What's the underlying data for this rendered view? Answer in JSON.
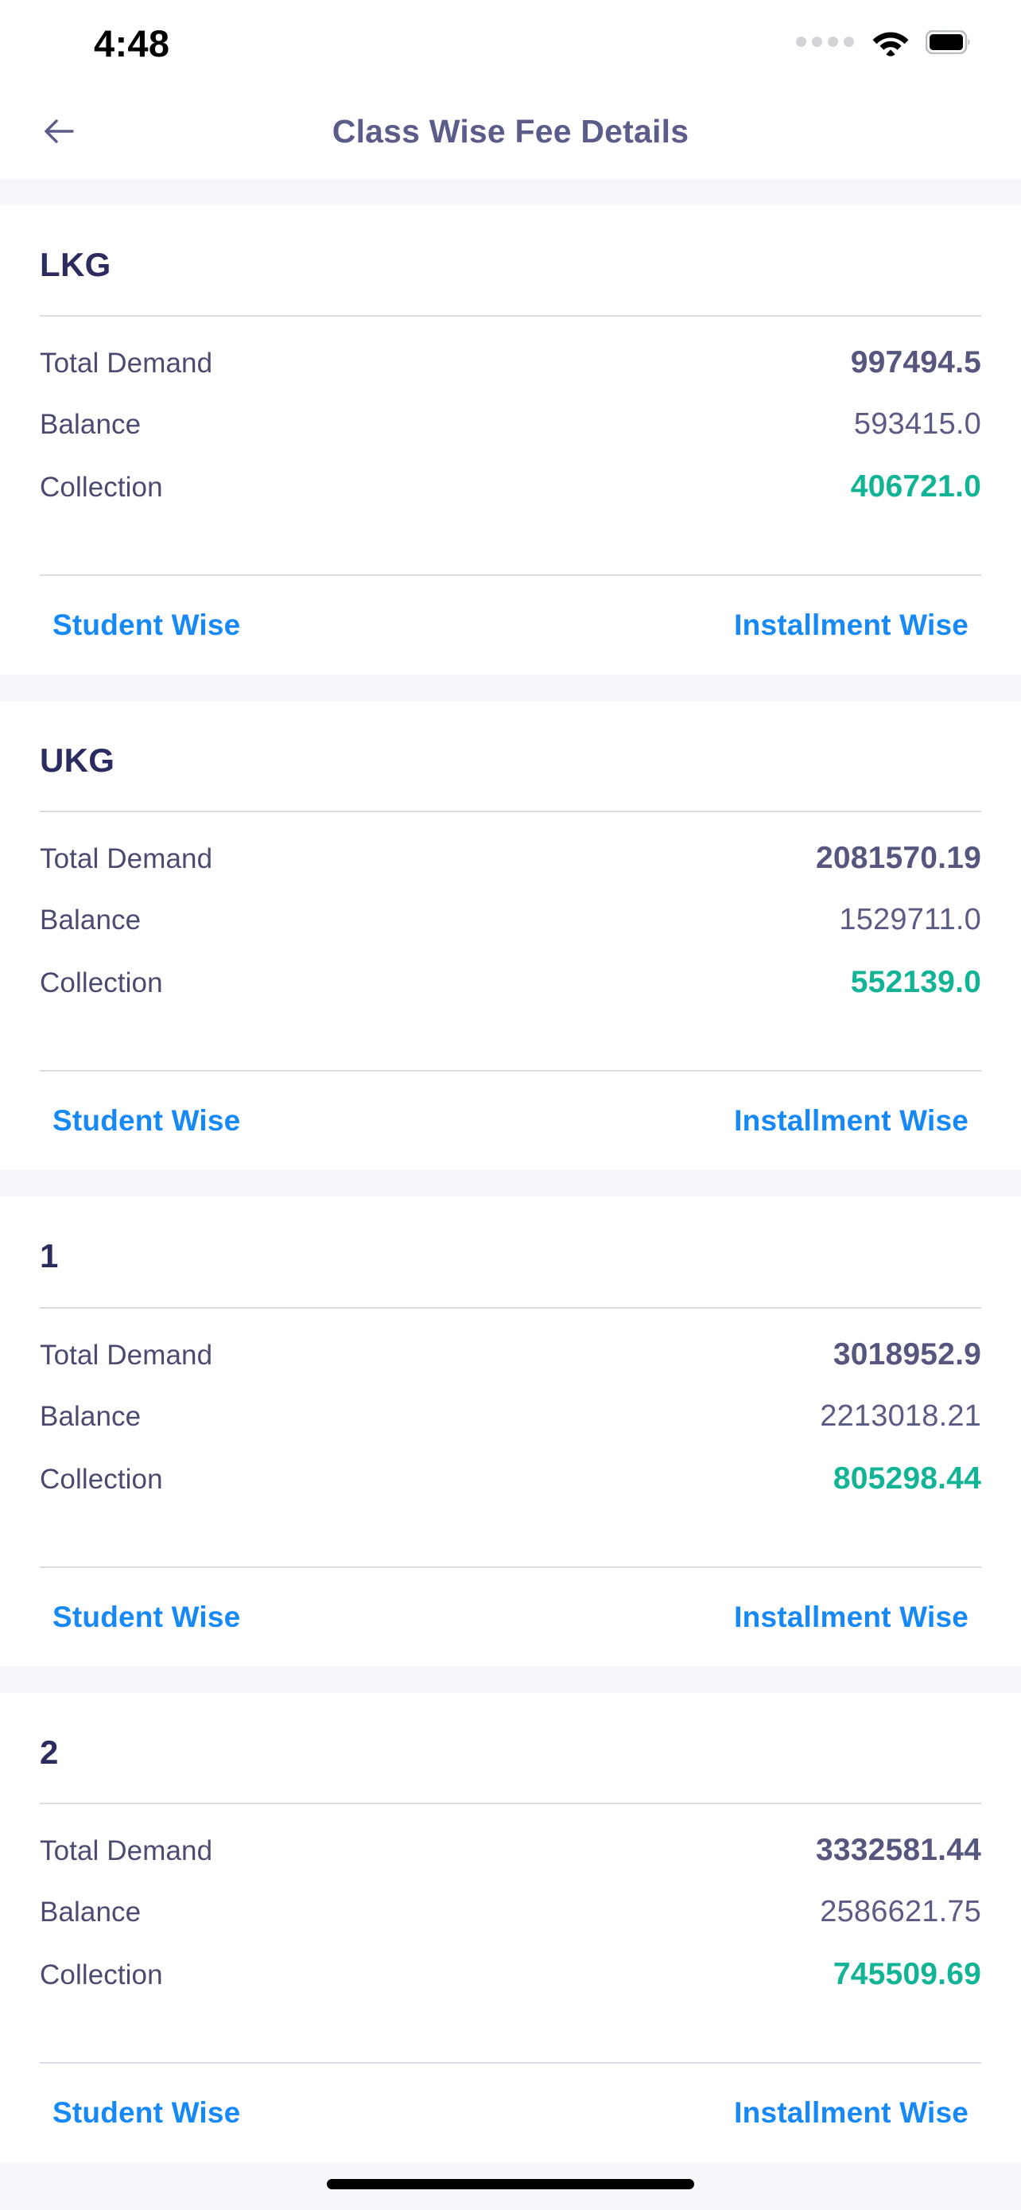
{
  "status_bar": {
    "time": "4:48",
    "signal_icon": "signal-dots-icon",
    "wifi_icon": "wifi-icon",
    "battery_icon": "battery-full-icon"
  },
  "app_bar": {
    "back_icon": "arrow-left-icon",
    "title": "Class Wise Fee Details"
  },
  "labels": {
    "total_demand": "Total Demand",
    "balance": "Balance",
    "collection": "Collection",
    "student_wise": "Student Wise",
    "installment_wise": "Installment Wise"
  },
  "colors": {
    "title": "#5c5c8a",
    "heading": "#2b2b5f",
    "label": "#4b4b72",
    "value": "#5b5b85",
    "collection": "#12b495",
    "link": "#1789f7",
    "divider": "#dcdce4",
    "page_background": "#f6f7fa",
    "card_background": "#ffffff"
  },
  "cards": [
    {
      "class_name": "LKG",
      "total_demand": "997494.5",
      "balance": "593415.0",
      "collection": "406721.0"
    },
    {
      "class_name": "UKG",
      "total_demand": "2081570.19",
      "balance": "1529711.0",
      "collection": "552139.0"
    },
    {
      "class_name": "1",
      "total_demand": "3018952.9",
      "balance": "2213018.21",
      "collection": "805298.44"
    },
    {
      "class_name": "2",
      "total_demand": "3332581.44",
      "balance": "2586621.75",
      "collection": "745509.69"
    }
  ]
}
